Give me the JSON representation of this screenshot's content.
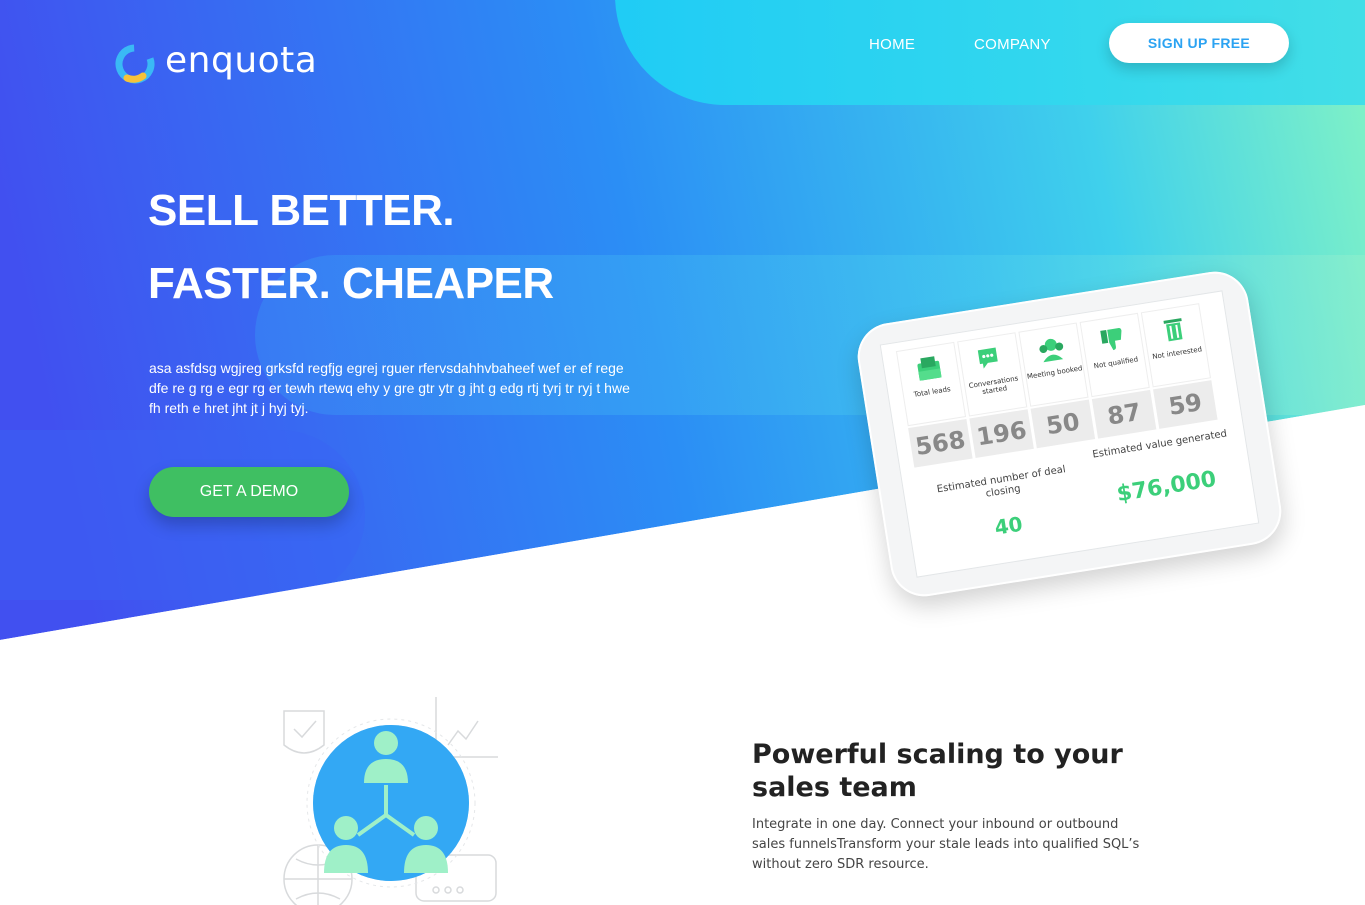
{
  "brand": {
    "name": "enquota",
    "accent": "#2ba3f2",
    "green": "#3fbf62"
  },
  "nav": {
    "home": "HOME",
    "company": "COMPANY",
    "signup": "SIGN UP FREE"
  },
  "hero": {
    "line1": "SELL BETTER.",
    "line2": "FASTER. CHEAPER",
    "body": "asa asfdsg wgjreg grksfd regfjg egrej rguer rfervsdahhvbaheef wef er ef rege dfe re g rg e egr rg er tewh rtewq ehy y gre gtr ytr g jht g edg rtj tyrj tr ryj t hwe fh reth e hret jht jt j hyj tyj.",
    "cta": "GET A DEMO"
  },
  "dashboard": {
    "stats": [
      {
        "label": "Total leads",
        "value": "568",
        "icon": "inbox-icon"
      },
      {
        "label": "Conversations started",
        "value": "196",
        "icon": "chat-icon"
      },
      {
        "label": "Meeting booked",
        "value": "50",
        "icon": "meeting-icon"
      },
      {
        "label": "Not qualified",
        "value": "87",
        "icon": "thumbs-down-icon"
      },
      {
        "label": "Not interested",
        "value": "59",
        "icon": "trash-icon"
      }
    ],
    "deal_label": "Estimated number of deal closing",
    "deal_value": "40",
    "value_label": "Estimated value generated",
    "value_value": "$76,000"
  },
  "feature": {
    "title": "Powerful scaling to your sales team",
    "body": "Integrate in one day. Connect your inbound or outbound sales funnelsTransform your stale leads into qualified SQL’s without zero SDR resource."
  }
}
